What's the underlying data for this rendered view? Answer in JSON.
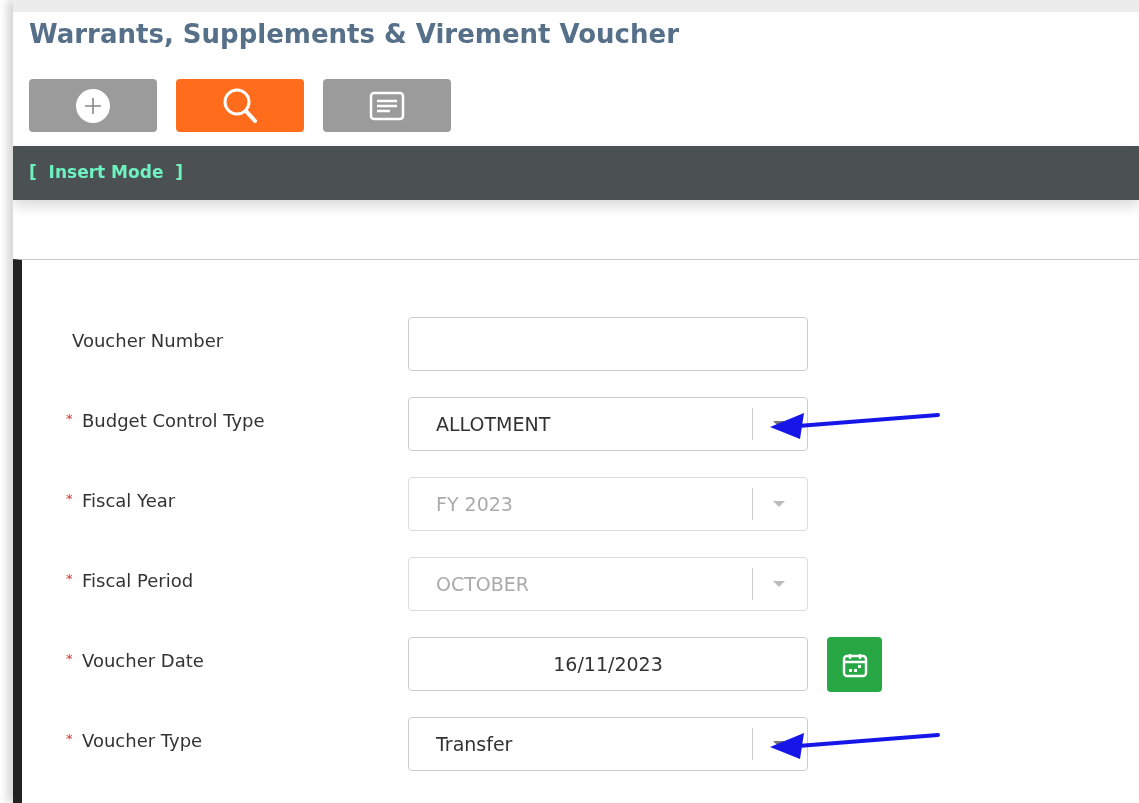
{
  "page": {
    "title": "Warrants, Supplements & Virement Voucher"
  },
  "toolbar": [
    {
      "kind": "add",
      "selected": false
    },
    {
      "kind": "search",
      "selected": true
    },
    {
      "kind": "list",
      "selected": false
    }
  ],
  "mode_bar": {
    "text": "[  Insert Mode  ]"
  },
  "form": {
    "fields": [
      {
        "label": "Voucher Number",
        "kind": "text",
        "disabled": false,
        "pointer_arrow": false
      },
      {
        "required_mark": "*",
        "label": "Budget Control Type",
        "kind": "select",
        "value": "ALLOTMENT",
        "disabled": false,
        "pointer_arrow": true
      },
      {
        "required_mark": "*",
        "label": "Fiscal Year",
        "kind": "select",
        "value": "FY 2023",
        "disabled": true,
        "pointer_arrow": false
      },
      {
        "required_mark": "*",
        "label": "Fiscal Period",
        "kind": "select",
        "value": "OCTOBER",
        "disabled": true,
        "pointer_arrow": false
      },
      {
        "required_mark": "*",
        "label": "Voucher Date",
        "kind": "date",
        "value": "16/11/2023",
        "disabled": false,
        "pointer_arrow": false
      },
      {
        "required_mark": "*",
        "label": "Voucher Type",
        "kind": "select",
        "value": "Transfer",
        "disabled": false,
        "pointer_arrow": true
      }
    ]
  }
}
